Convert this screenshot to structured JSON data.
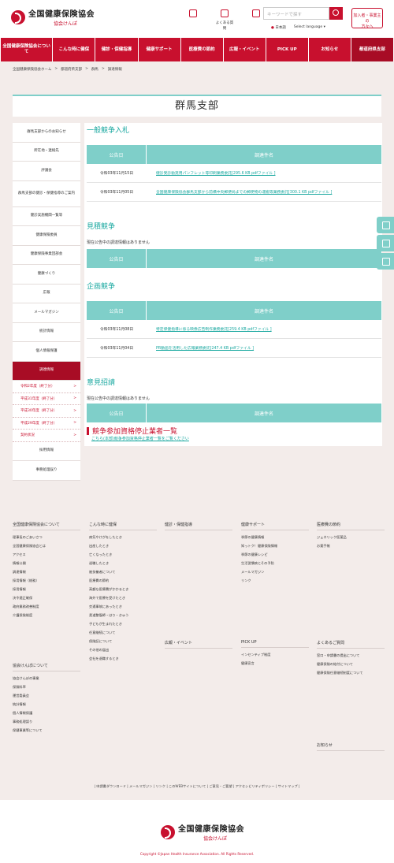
{
  "header": {
    "logo_main": "全国健康保険協会",
    "logo_sub": "協会けんぽ",
    "icons": [
      {
        "label": "",
        "icon": "document-icon"
      },
      {
        "label": "よくある質問",
        "icon": "speech-icon"
      },
      {
        "label": "",
        "icon": "smartphone-icon"
      }
    ],
    "search_placeholder": "キーワードで探す",
    "lang_ja": "日本語",
    "lang_select": "Select language",
    "join_button_l1": "加入者・事業主の",
    "join_button_l2": "方々へ"
  },
  "gnav": [
    "全国健康保険協会について",
    "こんな時に健保",
    "健診・保健指導",
    "健康サポート",
    "医療費の節約",
    "広報・イベント",
    "PICK UP",
    "お知らせ",
    "都道府県支部"
  ],
  "breadcrumb": [
    "全国健康保険協会ホーム",
    "都道府県支部",
    "群馬",
    "調達情報"
  ],
  "page_title": "群馬支部",
  "side_nav": {
    "items_before": [
      "群馬支部からのお知らせ",
      "所在地・連絡先",
      "評議会",
      "群馬支部の健診・保健指導のご案内",
      "健診実施機関一覧等",
      "健康保険委員",
      "健康保険事業団部会",
      "健康づくり",
      "広報",
      "メールマガジン",
      "統計情報",
      "個人情報保護"
    ],
    "active": "調達情報",
    "sub_items": [
      "令和2年度（終了分）",
      "平成31年度（終了分）",
      "平成30年度（終了分）",
      "平成29年度（終了分）",
      "契約状況"
    ],
    "items_after": [
      "採用情報",
      "事務処理誤り"
    ]
  },
  "content": {
    "table_head_date": "公告日",
    "table_head_name": "調達件名",
    "sec1_title": "一般競争入札",
    "sec1_rows": [
      {
        "date": "令和03年11月15日",
        "name": "健診受診勧奨用パンフレット等印刷業務委託[295.6 KB pdfファイル ]"
      },
      {
        "date": "令和03年11月05日",
        "name": "全国健康保険協会群馬支部から前橋中央郵便局までの郵便物の運搬等業務委託[300.1 KB pdfファイル ]"
      }
    ],
    "sec2_title": "見積競争",
    "sec2_note": "現在公告中の調達情報はありません",
    "sec3_title": "企画競争",
    "sec3_rows": [
      {
        "date": "令和03年11月08日",
        "name": "特定保健指導に係る映像広告制作業務委託[259.4 KB pdfファイル ]"
      },
      {
        "date": "令和03年11月04日",
        "name": "PR動画を活用した広報業務委託[247.4 KB pdfファイル ]"
      }
    ],
    "sec4_title": "意見招請",
    "sec4_note": "現在公告中の調達情報はありません",
    "sec5_title": "競争参加資格停止業者一覧",
    "sec5_link": "こちら(本部)競争参加資格停止業者一覧をご覧ください"
  },
  "footer": {
    "col1": {
      "head": "全国健康保険協会について",
      "links": [
        "理事長のごあいさつ",
        "全国健康保険協会とは",
        "アクセス",
        "情報公開",
        "調達情報",
        "採用情報（総務）",
        "採用情報",
        "決令適正確保",
        "政府業務改善制度",
        "介護保険制度"
      ]
    },
    "col1b": {
      "head": "協会けんぽについて",
      "links": [
        "協会けんぽの事業",
        "保険料率",
        "運営委員会",
        "統計情報",
        "個人情報保護",
        "事務処理誤り",
        "保健事業等について"
      ]
    },
    "col2": {
      "head": "こんな時に健保",
      "links": [
        "病気やけがをしたとき",
        "出産したとき",
        "亡くなったとき",
        "退職したとき",
        "被扶養者について",
        "医療費の節約",
        "高額な医療費がかかるとき",
        "海外で医療を受けたとき",
        "交通事故にあったとき",
        "柔道整復師・はり・きゅう",
        "子どもが生まれたとき",
        "任意継続について",
        "保険証について",
        "その他の届出",
        "会社を退職するとき"
      ]
    },
    "col3": {
      "head": "健診・保健指導",
      "links": [
        "",
        "",
        "",
        "",
        "",
        "",
        "",
        ""
      ]
    },
    "col3b": {
      "head": "広報・イベント",
      "links": [
        "",
        "",
        "",
        "",
        "",
        ""
      ]
    },
    "col4": {
      "head": "健康サポート",
      "links": [
        "季節の健康情報",
        "知っトク！健康保険情報",
        "季節の健康レシピ",
        "生活習慣病とその予防",
        "メールマガジン",
        "リンク"
      ]
    },
    "col4b": {
      "head": "PICK UP",
      "links": [
        "インセンティブ制度",
        "健康宣言"
      ]
    },
    "col5": {
      "head": "医療費の節約",
      "links": [
        "ジェネリック医薬品",
        "お薬手帳"
      ]
    },
    "col5b": {
      "head": "よくあるご質問",
      "links": [
        "窓口・申請書の提出について",
        "健康保険の給付について",
        "健康保険任意継続制度について",
        ""
      ]
    },
    "col5c": {
      "head": "お知らせ",
      "links": []
    },
    "bottom_links": "| 申請書ダウンロード | メールマガジン | リンク | このWEBサイトについて | ご意見・ご要望 | アクセシビリティポリシー | サイトマップ |",
    "copyright": "Copyright ©Japan Health Insurance Association. All Rights Reserved."
  }
}
